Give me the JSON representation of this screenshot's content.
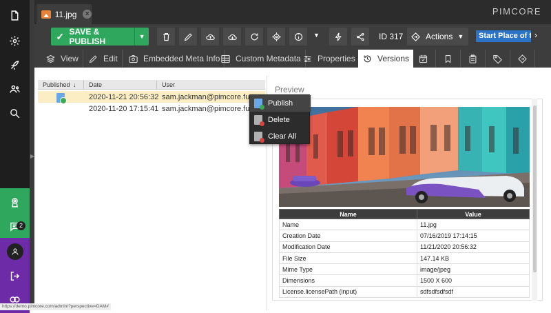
{
  "document_tab": {
    "title": "11.jpg"
  },
  "brand": {
    "logo_text": "PIMCORE"
  },
  "toolbar": {
    "save_label": "SAVE & PUBLISH",
    "id_label": "ID 317",
    "actions_label": "Actions",
    "selected_text": "Start Place of the"
  },
  "subtabs": [
    {
      "label": "View"
    },
    {
      "label": "Edit"
    },
    {
      "label": "Embedded Meta Info"
    },
    {
      "label": "Custom Metadata"
    },
    {
      "label": "Properties"
    },
    {
      "label": "Versions"
    }
  ],
  "sidebar": {
    "notification_count": "2"
  },
  "versions": {
    "columns": [
      "Published",
      "Date",
      "User"
    ],
    "rows": [
      {
        "date": "2020-11-21 20:56:32",
        "user": "sam.jackman@pimcore.fun",
        "published": true
      },
      {
        "date": "2020-11-20 17:15:41",
        "user": "sam.jackman@pimcore.fun",
        "published": false
      }
    ]
  },
  "context_menu": {
    "items": [
      "Publish",
      "Delete",
      "Clear All"
    ]
  },
  "preview": {
    "title": "Preview",
    "table_header": [
      "Name",
      "Value"
    ],
    "rows": [
      {
        "name": "Name",
        "value": "11.jpg"
      },
      {
        "name": "Creation Date",
        "value": "07/16/2019 17:14:15"
      },
      {
        "name": "Modification Date",
        "value": "11/21/2020 20:56:32"
      },
      {
        "name": "File Size",
        "value": "147.14 KB"
      },
      {
        "name": "Mime Type",
        "value": "image/jpeg"
      },
      {
        "name": "Dimensions",
        "value": "1500 X 600"
      },
      {
        "name": "License.licensePath (input)",
        "value": "sdfsdfsdfsdf"
      }
    ]
  },
  "statusbar": {
    "url": "https://demo.pimcore.com/admin/?perspective=DAM#"
  },
  "colors": {
    "accent_green": "#2fa85d",
    "accent_purple": "#6e2ba8",
    "selection_blue": "#2a73c7"
  }
}
